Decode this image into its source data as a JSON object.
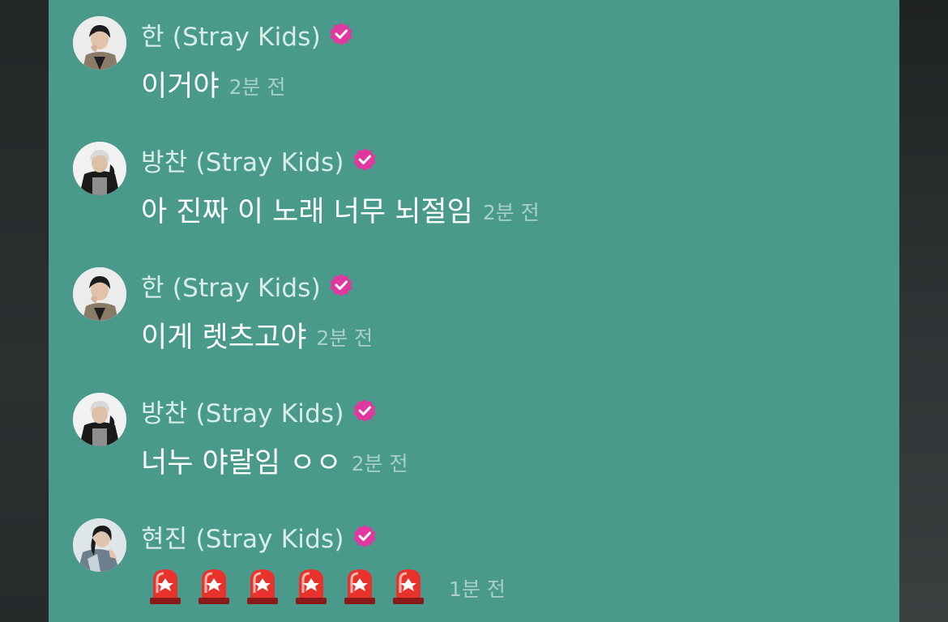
{
  "colors": {
    "panel_bg": "#4a9a8b",
    "name_text": "#d9ede8",
    "message_text": "#ffffff",
    "time_text": "#a9d0c7",
    "verified_badge": "#e0389e"
  },
  "messages": [
    {
      "author": "한 (Stray Kids)",
      "text": "이거야",
      "time": "2분 전",
      "avatar": "han-avatar"
    },
    {
      "author": "방찬 (Stray Kids)",
      "text": "아 진짜 이 노래 너무 뇌절임",
      "time": "2분 전",
      "avatar": "bangchan-avatar"
    },
    {
      "author": "한 (Stray Kids)",
      "text": "이게 렛츠고야",
      "time": "2분 전",
      "avatar": "han-avatar"
    },
    {
      "author": "방찬 (Stray Kids)",
      "text": "너누 야랄임 ㅇㅇ",
      "time": "2분 전",
      "avatar": "bangchan-avatar"
    },
    {
      "author": "현진 (Stray Kids)",
      "text": "🚨🚨🚨🚨🚨🚨",
      "emoji": "siren-icon",
      "emoji_count": 6,
      "time": "1분 전",
      "avatar": "hyunjin-avatar"
    }
  ]
}
